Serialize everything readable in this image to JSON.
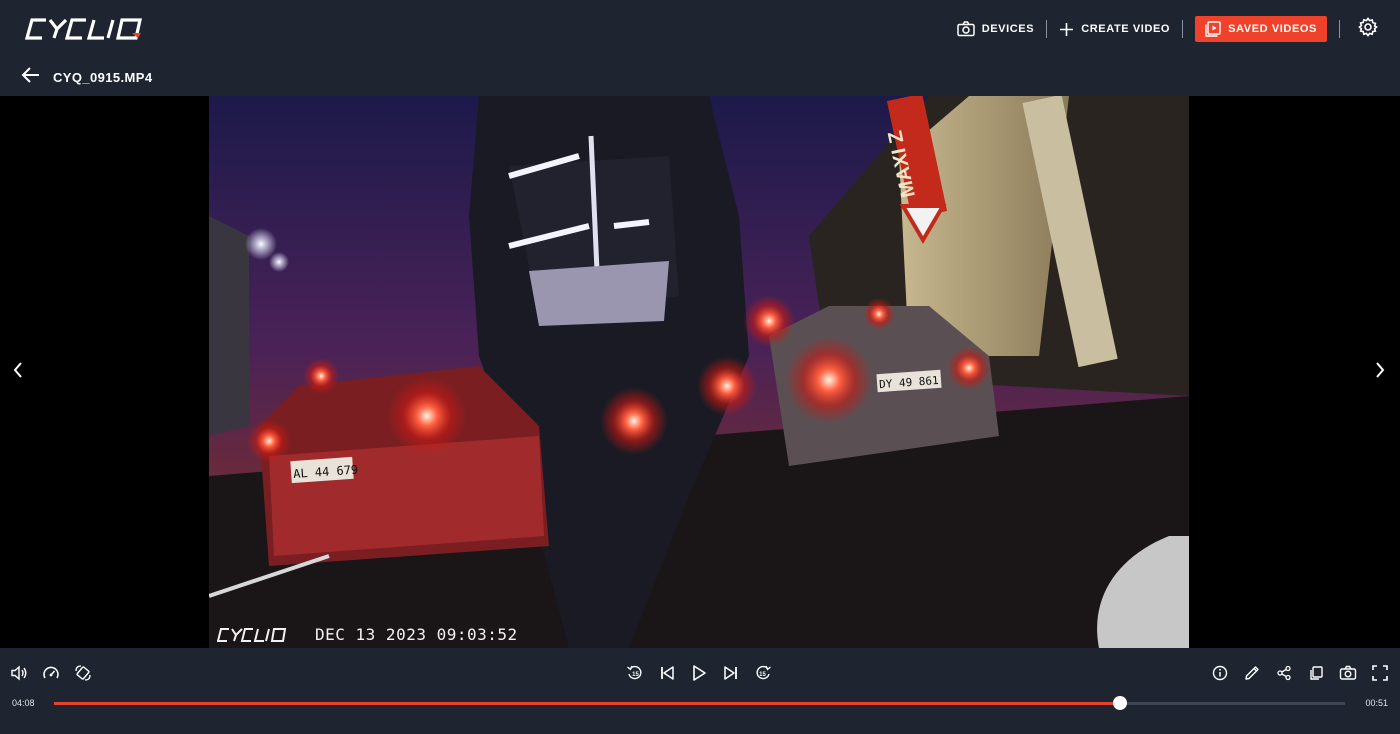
{
  "brand": {
    "logo_text": "CYCLIQ"
  },
  "nav": {
    "devices_label": "DEVICES",
    "create_label": "CREATE VIDEO",
    "saved_label": "SAVED VIDEOS",
    "active_color": "#f0422b"
  },
  "file": {
    "name": "CYQ_0915.MP4"
  },
  "overlay": {
    "logo_text": "CYCLIQ",
    "timestamp": "DEC 13 2023 09:03:52"
  },
  "video_scene": {
    "plate_left": "AL 44 679",
    "plate_right": "DY 49 861",
    "sign_text": "MAXI Z"
  },
  "player": {
    "current_time": "04:08",
    "duration": "00:51",
    "progress": 0.826,
    "progress_color": "#e8412c"
  },
  "icons": {
    "left": [
      "volume-icon",
      "speed-icon",
      "rotate-icon"
    ],
    "center": [
      "rewind-15-icon",
      "skip-previous-icon",
      "play-icon",
      "skip-next-icon",
      "forward-15-icon"
    ],
    "right": [
      "info-icon",
      "edit-icon",
      "share-icon",
      "copy-icon",
      "snapshot-icon",
      "fullscreen-icon"
    ]
  }
}
